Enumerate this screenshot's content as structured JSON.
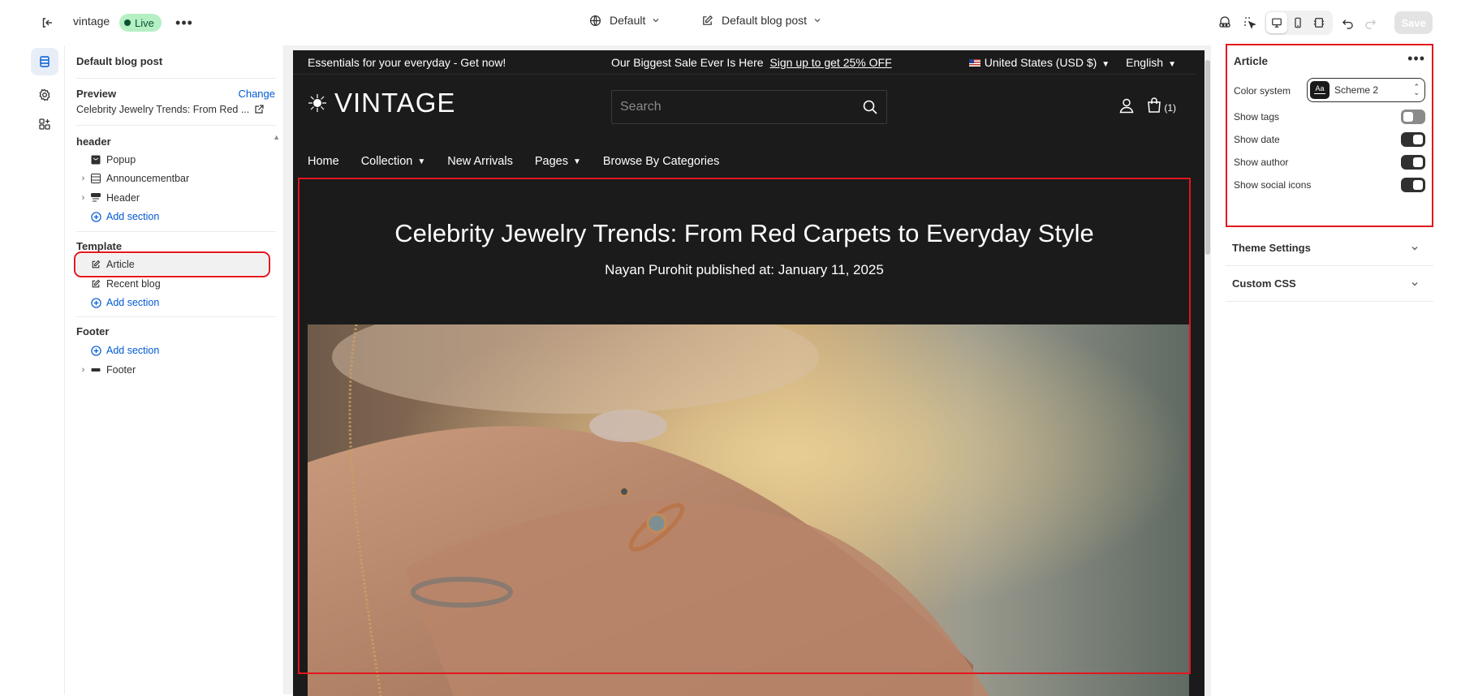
{
  "topbar": {
    "store_name": "vintage",
    "live_label": "Live",
    "theme_label": "Default",
    "template_label": "Default blog post",
    "save_label": "Save"
  },
  "left_panel": {
    "title": "Default blog post",
    "preview_label": "Preview",
    "change_label": "Change",
    "preview_value": "Celebrity Jewelry Trends: From Red ...",
    "groups": {
      "header": {
        "label": "header",
        "items": [
          "Popup",
          "Announcementbar",
          "Header"
        ],
        "add_label": "Add section"
      },
      "template": {
        "label": "Template",
        "items": [
          "Article",
          "Recent blog"
        ],
        "add_label": "Add section"
      },
      "footer": {
        "label": "Footer",
        "add_label": "Add section",
        "items": [
          "Footer"
        ]
      }
    }
  },
  "store": {
    "announcement_left": "Essentials for your everyday - Get now!",
    "announcement_center": "Our Biggest Sale Ever Is Here",
    "announcement_link": "Sign up to get 25% OFF",
    "currency": "United States (USD $)",
    "language": "English",
    "logo_text": "VINTAGE",
    "search_placeholder": "Search",
    "cart_count": "(1)",
    "nav": [
      "Home",
      "Collection",
      "New Arrivals",
      "Pages",
      "Browse By Categories"
    ],
    "article_title": "Celebrity Jewelry Trends: From Red Carpets to Everyday Style",
    "article_meta": "Nayan Purohit published at: January 11, 2025"
  },
  "right_panel": {
    "title": "Article",
    "color_system_label": "Color system",
    "scheme_label": "Scheme 2",
    "swatch_text": "Aa",
    "toggles": [
      {
        "label": "Show tags",
        "on": false
      },
      {
        "label": "Show date",
        "on": true
      },
      {
        "label": "Show author",
        "on": true
      },
      {
        "label": "Show social icons",
        "on": true
      }
    ],
    "accordions": [
      "Theme Settings",
      "Custom CSS"
    ]
  },
  "colors": {
    "accent_blue": "#005bd3",
    "highlight_red": "#e3161e",
    "live_green": "#b4f0c4",
    "store_bg": "#1b1b1b"
  },
  "icons": [
    "exit-icon",
    "more-icon",
    "globe-icon",
    "template-edit-icon",
    "chevron-down-icon",
    "inspector-icon",
    "select-icon",
    "desktop-icon",
    "mobile-icon",
    "fullwidth-icon",
    "undo-icon",
    "redo-icon",
    "sections-icon",
    "settings-icon",
    "apps-icon",
    "external-link-icon",
    "search-icon",
    "account-icon",
    "cart-icon"
  ]
}
